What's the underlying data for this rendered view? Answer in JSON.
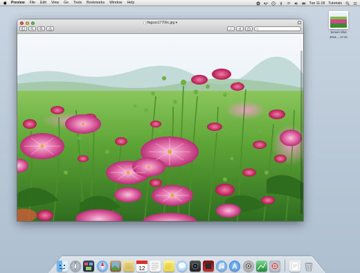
{
  "menubar": {
    "apple_icon": "apple-icon",
    "items": [
      "Preview",
      "File",
      "Edit",
      "View",
      "Go",
      "Tools",
      "Bookmarks",
      "Window",
      "Help"
    ],
    "clock": "Tue 11:18",
    "user": "Tutorials",
    "status_icons": [
      "stop-icon",
      "dropbox-icon",
      "time-machine-icon",
      "bluetooth-icon",
      "wifi-icon",
      "volume-icon",
      "battery-icon",
      "search-icon",
      "list-icon"
    ]
  },
  "desktop": {
    "icon_label_line1": "Screen Shot",
    "icon_label_line2": "2014-....17.41"
  },
  "window": {
    "title": "flagsss17709c.jpg",
    "search_placeholder": "",
    "image_description_colors": {
      "sky": "#e7eff7",
      "grass": "#6fb53a",
      "flower": "#d23d86",
      "dark_leaf": "#2f6d1f"
    }
  },
  "dock": {
    "apps": [
      "finder-icon",
      "launchpad-icon",
      "mission-control-icon",
      "safari-icon",
      "preview-icon",
      "notes-icon",
      "calendar-icon",
      "textedit-icon",
      "stickies-icon",
      "messages-icon",
      "facetime-icon",
      "photo-booth-icon",
      "itunes-icon",
      "app-store-icon",
      "system-preferences-icon",
      "grapher-icon",
      "utilities-icon"
    ],
    "stack_icon": "downloads-icon",
    "trash_icon": "trash-icon"
  }
}
